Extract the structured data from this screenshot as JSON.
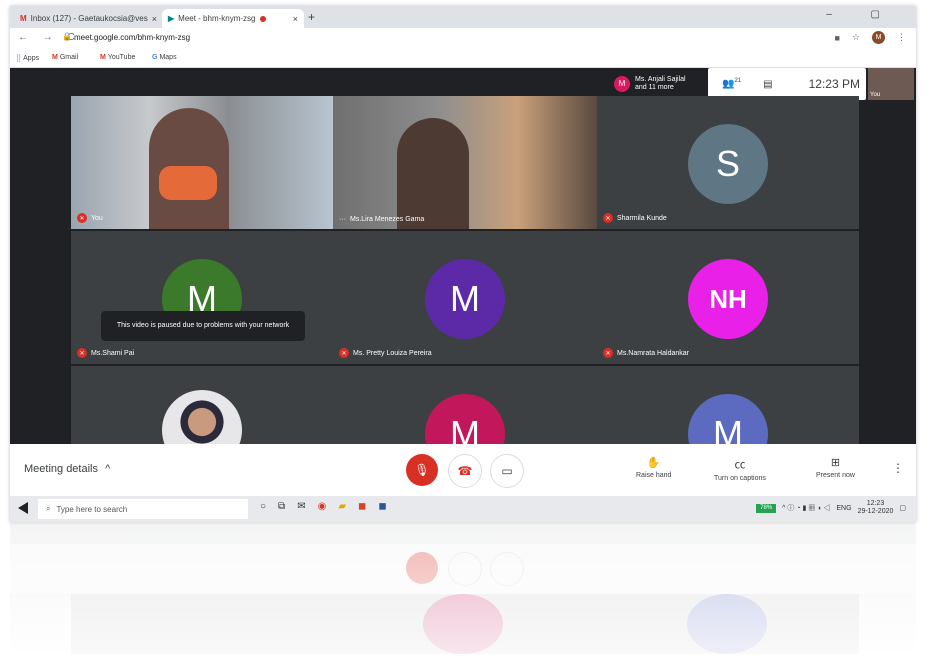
{
  "browser": {
    "tabs": [
      {
        "label": "Inbox (127) - Gaetaukocsia@ves",
        "close": "×"
      },
      {
        "label": "Meet - bhm-knym-zsg",
        "close": "×"
      }
    ],
    "new_tab": "+",
    "window_controls": "– ▢",
    "url": "meet.google.com/bhm-knym-zsg",
    "bookmarks": {
      "apps": "Apps",
      "gmail": "Gmail",
      "youtube": "YouTube",
      "maps": "Maps"
    },
    "profile_initial": "M"
  },
  "meet": {
    "participants_chip": {
      "initial": "M",
      "line1": "Ms. Anjali Sajilal",
      "line2": "and 11 more"
    },
    "people_count": "21",
    "time": "12:23 PM",
    "self_thumb_label": "You",
    "tiles": [
      {
        "name": "You"
      },
      {
        "name": "Ms.Lira Menezes Gama"
      },
      {
        "name": "Sharmila Kunde",
        "initial": "S",
        "color": "#5f7684"
      },
      {
        "name": "Ms.Shami Pai",
        "initial": "M",
        "color": "#3b7a2a",
        "paused": "This video is paused due to problems with your network"
      },
      {
        "name": "Ms. Pretty Louiza Pereira",
        "initial": "M",
        "color": "#5c2aa6"
      },
      {
        "name": "Ms.Namrata Haldankar",
        "initial": "NH",
        "color": "#e820e8"
      },
      {
        "name": ""
      },
      {
        "initial": "M",
        "color": "#c2185b"
      },
      {
        "initial": "M",
        "color": "#5c6bc0"
      }
    ],
    "bottom": {
      "meeting_details": "Meeting details",
      "raise_hand": "Raise hand",
      "captions": "Turn on captions",
      "present": "Present now",
      "more": "⋮"
    }
  },
  "taskbar": {
    "search_placeholder": "Type here to search",
    "battery": "78%",
    "lang": "ENG",
    "time": "12:23",
    "date": "29-12-2020"
  }
}
